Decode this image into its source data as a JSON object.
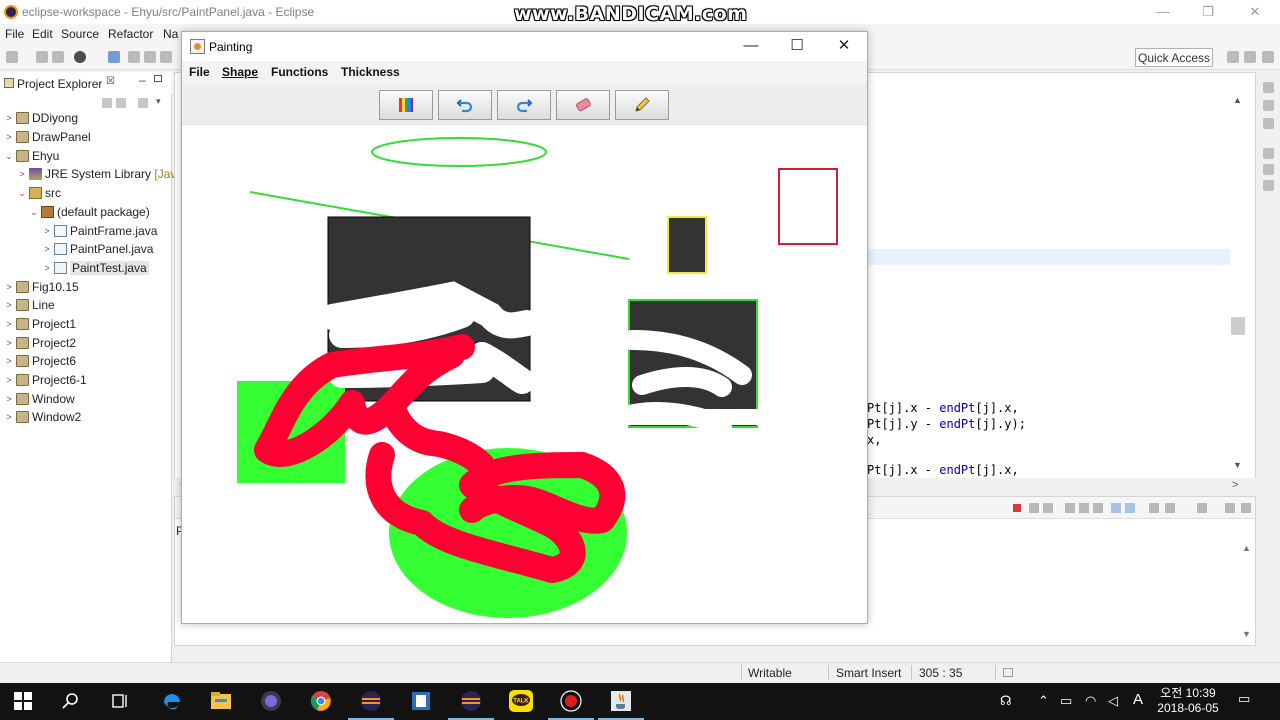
{
  "eclipse": {
    "title": "eclipse-workspace - Ehyu/src/PaintPanel.java - Eclipse",
    "watermark": "www.BANDICAM.com",
    "menu": [
      "File",
      "Edit",
      "Source",
      "Refactor",
      "Na"
    ],
    "quick_access": "Quick Access",
    "project_explorer": {
      "title": "Project Explorer",
      "close_glyph": "☒",
      "items": [
        {
          "label": "DDiyong",
          "arrow": ">",
          "icon": "project-icon"
        },
        {
          "label": "DrawPanel",
          "arrow": ">",
          "icon": "project-icon"
        },
        {
          "label": "Ehyu",
          "arrow": "⌄",
          "icon": "project-icon"
        },
        {
          "label": "JRE System Library",
          "suffix": "[Java",
          "arrow": ">",
          "icon": "library-icon"
        },
        {
          "label": "src",
          "arrow": "⌄",
          "icon": "source-folder-icon"
        },
        {
          "label": "(default package)",
          "arrow": "⌄",
          "icon": "package-icon"
        },
        {
          "label": "PaintFrame.java",
          "arrow": ">",
          "icon": "java-file-icon"
        },
        {
          "label": "PaintPanel.java",
          "arrow": ">",
          "icon": "java-file-icon"
        },
        {
          "label": "PaintTest.java",
          "arrow": ">",
          "icon": "java-file-icon",
          "selected": true
        },
        {
          "label": "Fig10.15",
          "arrow": ">",
          "icon": "project-icon"
        },
        {
          "label": "Line",
          "arrow": ">",
          "icon": "project-icon"
        },
        {
          "label": "Project1",
          "arrow": ">",
          "icon": "project-icon"
        },
        {
          "label": "Project2",
          "arrow": ">",
          "icon": "project-icon"
        },
        {
          "label": "Project6",
          "arrow": ">",
          "icon": "project-icon"
        },
        {
          "label": "Project6-1",
          "arrow": ">",
          "icon": "project-icon"
        },
        {
          "label": "Window",
          "arrow": ">",
          "icon": "project-icon"
        },
        {
          "label": "Window2",
          "arrow": ">",
          "icon": "project-icon"
        }
      ]
    },
    "editor": {
      "code_lines": [
        {
          "pre": "Pt[j].x - ",
          "kw": "endPt",
          "post": "[j].x,"
        },
        {
          "pre": "Pt[j].y - ",
          "kw": "endPt",
          "post": "[j].y);"
        },
        {
          "pre": "x,",
          "kw": "",
          "post": ""
        },
        {
          "pre": "",
          "kw": "",
          "post": ""
        },
        {
          "pre": "Pt[j].x - ",
          "kw": "endPt",
          "post": "[j].x,"
        }
      ]
    },
    "bottom_panel_label": "P",
    "status": {
      "writable": "Writable",
      "insert_mode": "Smart Insert",
      "position": "305 : 35"
    }
  },
  "painting": {
    "title": "Painting",
    "window_buttons": {
      "minimize": "—",
      "maximize": "☐",
      "close": "✕"
    },
    "menu": [
      {
        "label": "File",
        "underline": false
      },
      {
        "label": "Shape",
        "underline": true
      },
      {
        "label": "Functions",
        "underline": false
      },
      {
        "label": "Thickness",
        "underline": false
      }
    ],
    "tools": [
      {
        "name": "color-palette-icon"
      },
      {
        "name": "undo-icon"
      },
      {
        "name": "redo-icon"
      },
      {
        "name": "eraser-icon"
      },
      {
        "name": "pencil-icon"
      }
    ],
    "colors": {
      "dark_fill": "#333333",
      "green": "#33ff33",
      "green_line": "#33dd33",
      "red_stroke": "#ff0033",
      "red_rect": "#cc2233",
      "yellow_outline": "#f5e642"
    }
  },
  "taskbar": {
    "apps": [
      "windows-start-icon",
      "search-icon",
      "task-view-icon",
      "edge-icon",
      "file-explorer-icon",
      "media-icon",
      "chrome-icon",
      "eclipse-icon",
      "app-icon",
      "eclipse-icon",
      "kakaotalk-icon",
      "bandicam-record-icon",
      "java-icon"
    ],
    "kakao_label": "TALK",
    "clock_time": "오전 10:39",
    "clock_date": "2018-06-05",
    "ime": "A"
  }
}
